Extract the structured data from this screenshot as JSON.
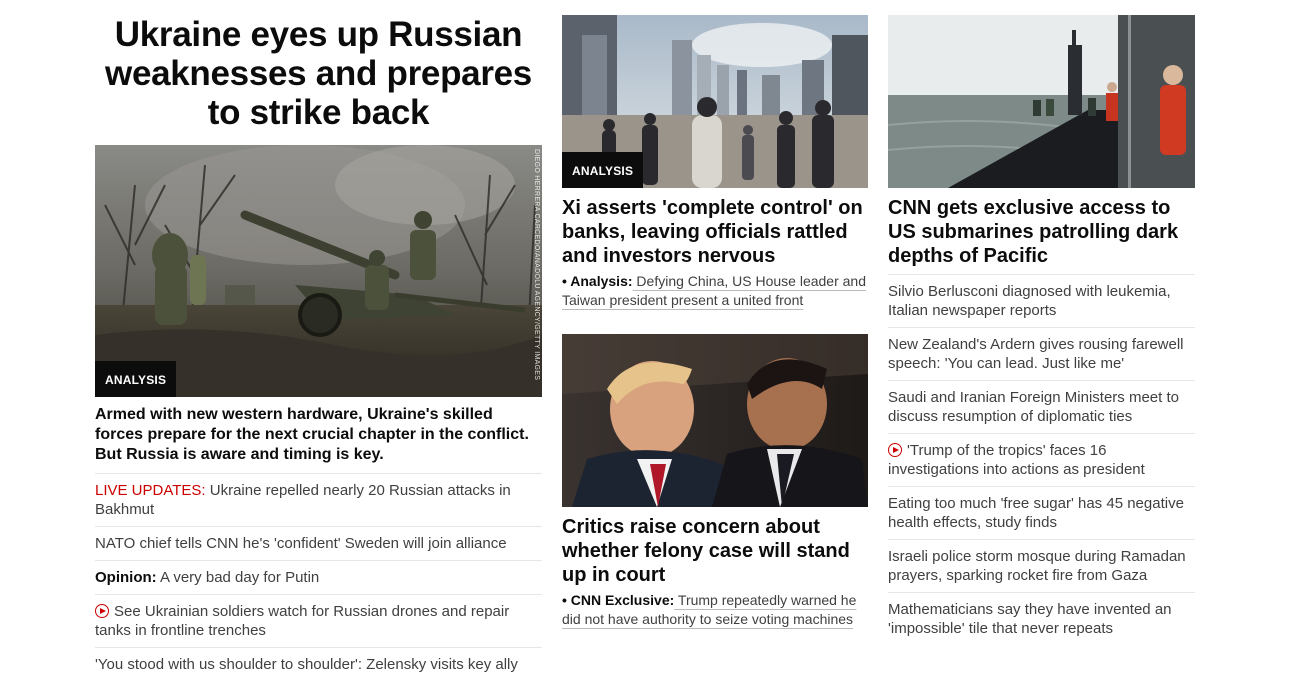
{
  "col1": {
    "hero_title": "Ukraine eyes up Russian weaknesses and prepares to strike back",
    "photo_badge": "ANALYSIS",
    "photo_credit": "DIEGO HERRERA CARCEDO/ANADOLU AGENCY/GETTY IMAGES",
    "deck": "Armed with new western hardware, Ukraine's skilled forces prepare for the next crucial chapter in the conflict. But Russia is aware and timing is key.",
    "related": [
      {
        "prefix": "LIVE UPDATES:",
        "text": " Ukraine repelled nearly 20 Russian attacks in Bakhmut"
      },
      {
        "text": "NATO chief tells CNN he's 'confident' Sweden will join alliance"
      },
      {
        "bold": "Opinion:",
        "text": " A very bad day for Putin"
      },
      {
        "video": true,
        "text": "See Ukrainian soldiers watch for Russian drones and repair tanks in frontline trenches"
      },
      {
        "text": "'You stood with us shoulder to shoulder': Zelensky visits key ally"
      }
    ]
  },
  "col2": {
    "story1": {
      "badge": "ANALYSIS",
      "headline": "Xi asserts 'complete control' on banks, leaving officials rattled and investors nervous",
      "sub_bold": "• Analysis:",
      "sub_text": " Defying China, US House leader and Taiwan president present a united front"
    },
    "story2": {
      "headline": "Critics raise concern about whether felony case will stand up in court",
      "sub_bold": "• CNN Exclusive:",
      "sub_text": " Trump repeatedly warned he did not have authority to seize voting machines"
    }
  },
  "col3": {
    "headline": "CNN gets exclusive access to US submarines patrolling dark depths of Pacific",
    "list": [
      {
        "text": "Silvio Berlusconi diagnosed with leukemia, Italian newspaper reports"
      },
      {
        "text": "New Zealand's Ardern gives rousing farewell speech: 'You can lead. Just like me'"
      },
      {
        "text": "Saudi and Iranian Foreign Ministers meet to discuss resumption of diplomatic ties"
      },
      {
        "video": true,
        "text": "'Trump of the tropics' faces 16 investigations into actions as president"
      },
      {
        "text": "Eating too much 'free sugar' has 45 negative health effects, study finds"
      },
      {
        "text": "Israeli police storm mosque during Ramadan prayers, sparking rocket fire from Gaza"
      },
      {
        "text": "Mathematicians say they have invented an 'impossible' tile that never repeats"
      }
    ]
  },
  "colors": {
    "live_red": "#cc0000",
    "badge_bg": "#0c0c0c",
    "divider": "#e6e6e6"
  }
}
